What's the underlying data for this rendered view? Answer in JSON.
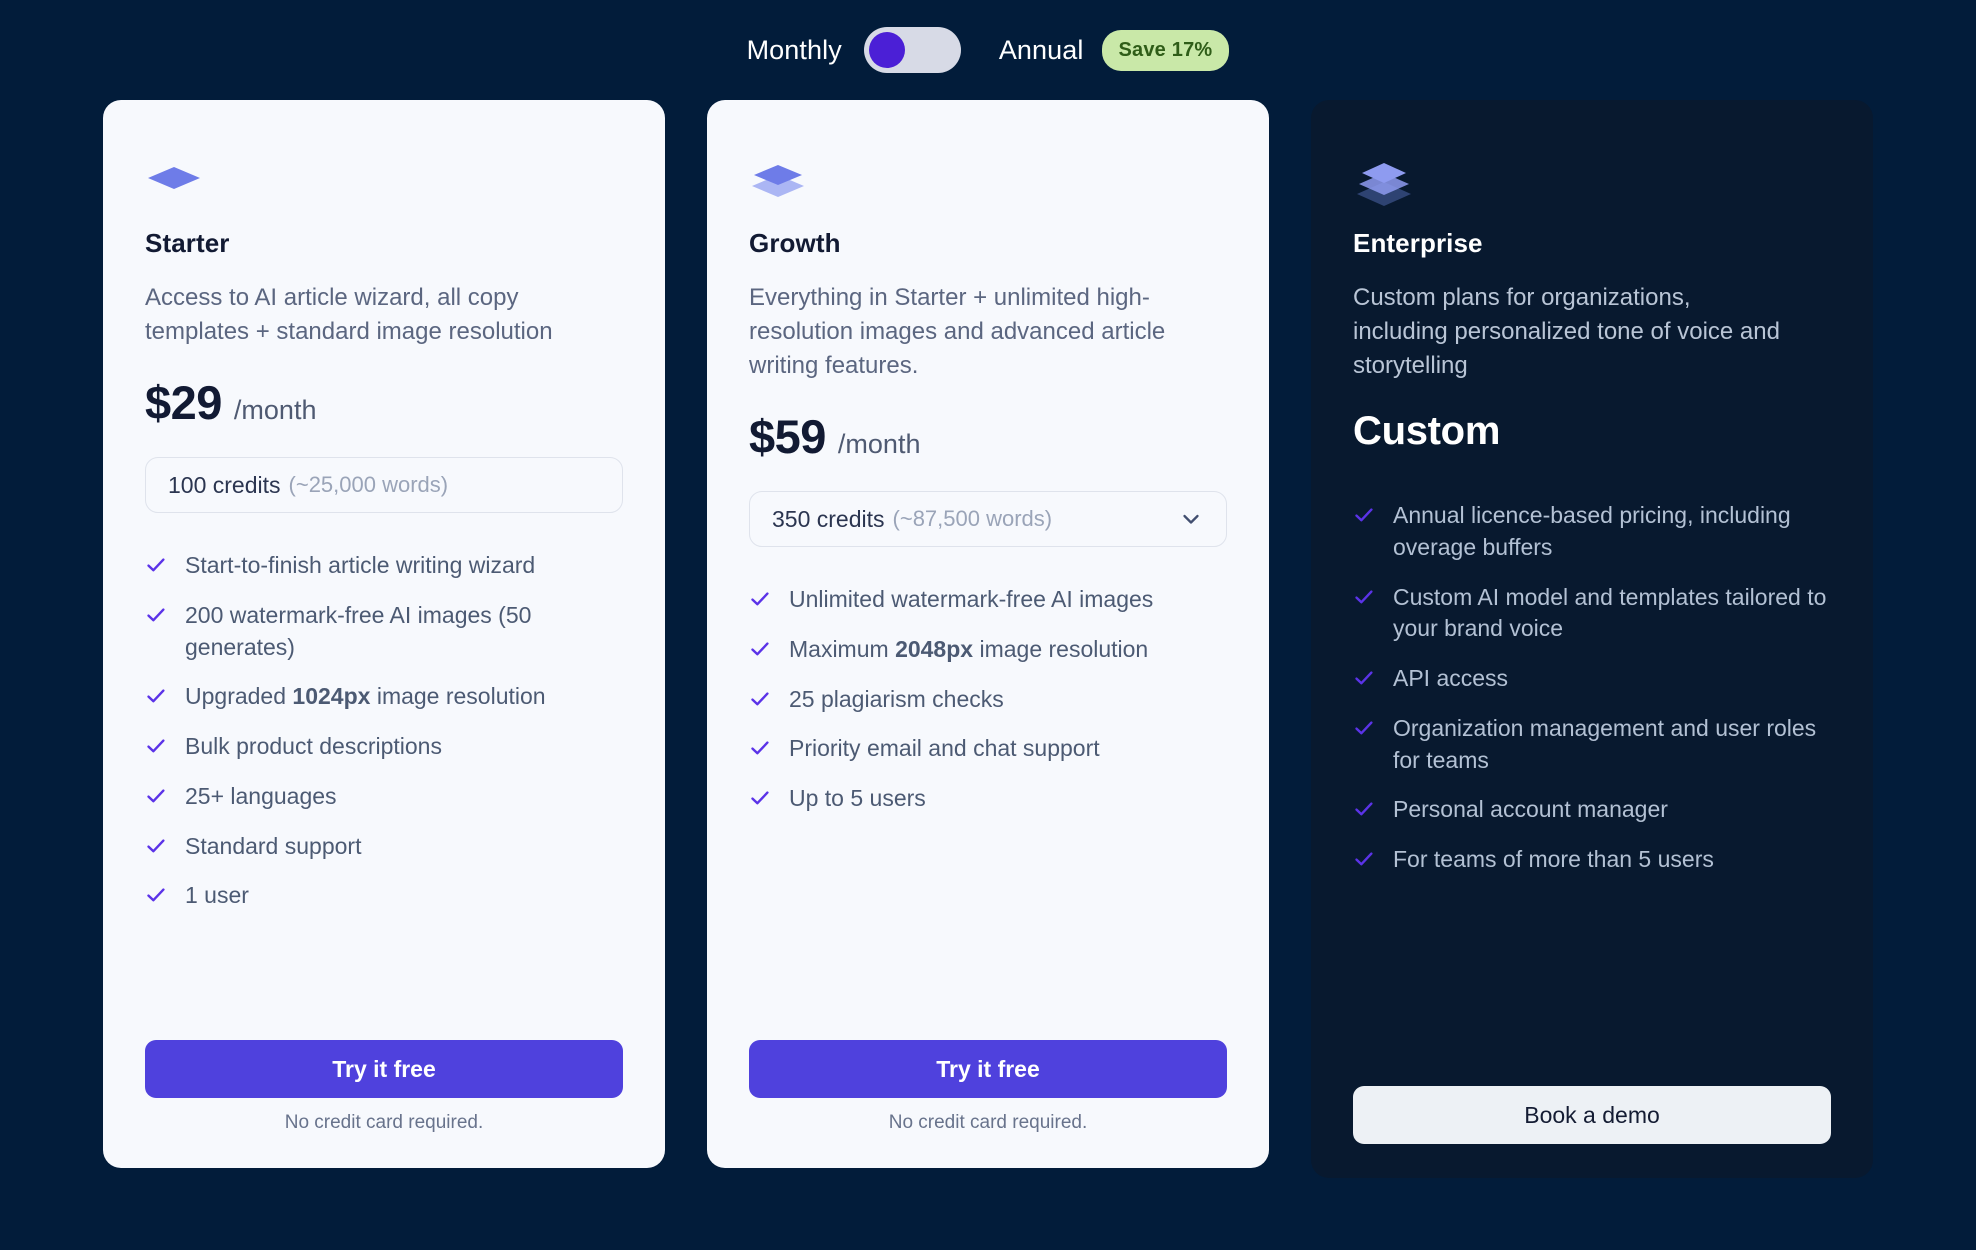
{
  "billing": {
    "monthly_label": "Monthly",
    "annual_label": "Annual",
    "save_badge": "Save 17%",
    "selected": "Monthly",
    "accent_color": "#4b1fd6",
    "badge_bg": "#c9e8a8",
    "badge_text_color": "#2f5d18"
  },
  "page": {
    "background_color": "#021c3a"
  },
  "plans": [
    {
      "icon": "layers-single-icon",
      "name": "Starter",
      "description": "Access to AI article wizard, all copy templates + standard image resolution",
      "price_amount": "$29",
      "price_period": "/month",
      "credits_main": "100 credits",
      "credits_sub": "(~25,000 words)",
      "has_chevron": false,
      "features": [
        {
          "text": "Start-to-finish article writing wizard"
        },
        {
          "text": "200 watermark-free AI images (50 generates)"
        },
        {
          "pre": "Upgraded ",
          "bold": "1024px",
          "post": " image resolution"
        },
        {
          "text": "Bulk product descriptions"
        },
        {
          "text": "25+ languages"
        },
        {
          "text": "Standard support"
        },
        {
          "text": "1 user"
        }
      ],
      "cta_label": "Try it free",
      "cta_note": "No credit card required.",
      "theme": "light"
    },
    {
      "icon": "layers-double-icon",
      "name": "Growth",
      "description": "Everything in Starter + unlimited high-resolution images and advanced article writing features.",
      "price_amount": "$59",
      "price_period": "/month",
      "credits_main": "350 credits",
      "credits_sub": "(~87,500 words)",
      "has_chevron": true,
      "features": [
        {
          "text": "Unlimited watermark-free AI images"
        },
        {
          "pre": "Maximum ",
          "bold": "2048px",
          "post": " image resolution"
        },
        {
          "text": "25 plagiarism checks"
        },
        {
          "text": "Priority email and chat support"
        },
        {
          "text": "Up to 5 users"
        }
      ],
      "cta_label": "Try it free",
      "cta_note": "No credit card required.",
      "theme": "light"
    },
    {
      "icon": "layers-triple-icon",
      "name": "Enterprise",
      "description": "Custom plans for organizations, including personalized tone of voice and storytelling",
      "price_custom": "Custom",
      "features": [
        {
          "text": "Annual licence-based pricing, including overage buffers"
        },
        {
          "text": "Custom AI model and templates tailored to your brand voice"
        },
        {
          "text": "API access"
        },
        {
          "text": "Organization management and user roles for teams"
        },
        {
          "text": "Personal account manager"
        },
        {
          "text": "For teams of more than 5 users"
        }
      ],
      "cta_label": "Book a demo",
      "theme": "dark"
    }
  ]
}
